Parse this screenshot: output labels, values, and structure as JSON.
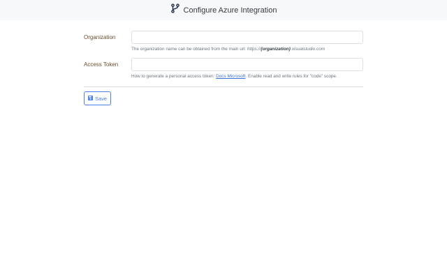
{
  "header": {
    "title": "Configure Azure Integration",
    "icon": "git-branch-icon"
  },
  "form": {
    "organization": {
      "label": "Organization",
      "value": "",
      "help_prefix": "The organization name can be obtained from the main url: ",
      "help_url_start": "https://",
      "help_url_bold": "{organization}",
      "help_url_end": ".visualstudio.com"
    },
    "token": {
      "label": "Access Token",
      "value": "",
      "help_prefix": "How to generate a personal access token: ",
      "help_link": "Docs Microsoft",
      "help_suffix": ". Enable read and write rules for \"code\" scope."
    }
  },
  "save_label": "Save",
  "colors": {
    "accent": "#4a7ff0",
    "label": "#6b4e2e"
  }
}
